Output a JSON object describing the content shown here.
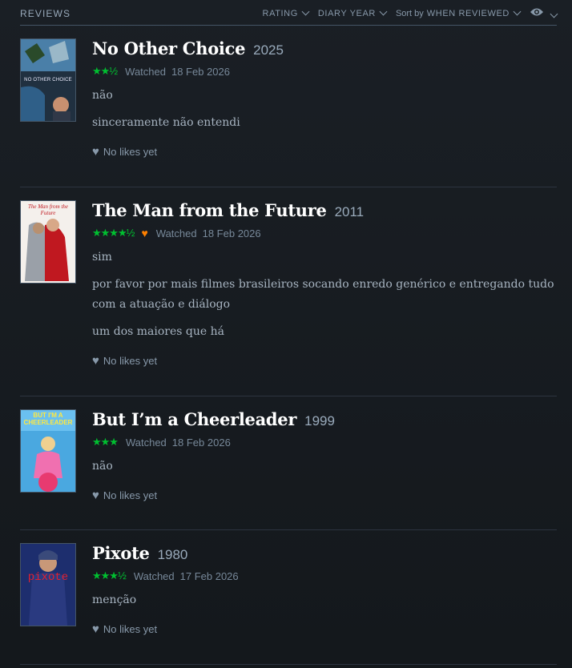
{
  "header": {
    "title": "REVIEWS",
    "rating_label": "RATING",
    "diary_year_label": "DIARY YEAR",
    "sort_prefix": "Sort by",
    "sort_value": "WHEN REVIEWED"
  },
  "reviews": [
    {
      "title": "No Other Choice",
      "year": "2025",
      "stars": "★★½",
      "liked": false,
      "watched_label": "Watched",
      "date": "18 Feb 2026",
      "paragraphs": [
        "não",
        "sinceramente não entendi"
      ],
      "likes": "No likes yet",
      "poster_text": "NO OTHER CHOICE"
    },
    {
      "title": "The Man from the Future",
      "year": "2011",
      "stars": "★★★★½",
      "liked": true,
      "watched_label": "Watched",
      "date": "18 Feb 2026",
      "paragraphs": [
        "sim",
        "por favor por mais filmes brasileiros socando enredo genérico e entregando tudo com a atuação e diálogo",
        "um dos maiores que há"
      ],
      "likes": "No likes yet",
      "poster_text": "The Man from the Future"
    },
    {
      "title": "But I’m a Cheerleader",
      "year": "1999",
      "stars": "★★★",
      "liked": false,
      "watched_label": "Watched",
      "date": "18 Feb 2026",
      "paragraphs": [
        "não"
      ],
      "likes": "No likes yet",
      "poster_text": "BUT I'M A CHEERLEADER"
    },
    {
      "title": "Pixote",
      "year": "1980",
      "stars": "★★★½",
      "liked": false,
      "watched_label": "Watched",
      "date": "17 Feb 2026",
      "paragraphs": [
        "menção"
      ],
      "likes": "No likes yet",
      "poster_text": "pixote"
    }
  ],
  "colors": {
    "star": "#00c030",
    "like": "#ff8000",
    "bg": "#14181c"
  }
}
